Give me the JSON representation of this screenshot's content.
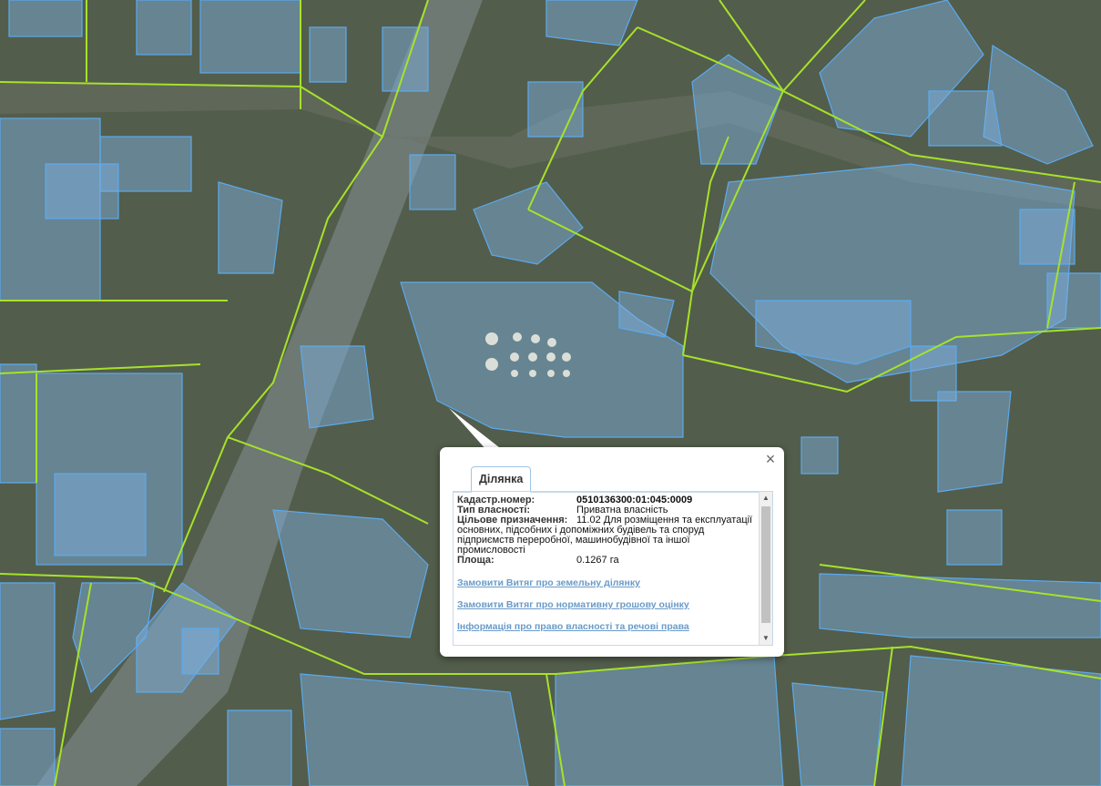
{
  "map": {
    "colors": {
      "parcel_fill": "#7fb4e6",
      "parcel_stroke": "#5aaaf0",
      "boundary": "#a6e22a"
    }
  },
  "popup": {
    "tab_label": "Ділянка",
    "close_icon": "close-icon",
    "fields": [
      {
        "label": "Кадастр.номер:",
        "value": "0510136300:01:045:0009"
      },
      {
        "label": "Тип власності:",
        "value": "Приватна власність"
      },
      {
        "label": "Цільове призначення:",
        "value": "11.02 Для розміщення та експлуатації основних, підсобних і допоміжних будівель та споруд підприємств переробної, машинобудівної та іншої промисловості"
      },
      {
        "label": "Площа:",
        "value": "0.1267 га"
      }
    ],
    "links": [
      "Замовити Витяг про земельну ділянку",
      "Замовити Витяг про нормативну грошову оцінку",
      "Інформація про право власності та речові права"
    ]
  }
}
